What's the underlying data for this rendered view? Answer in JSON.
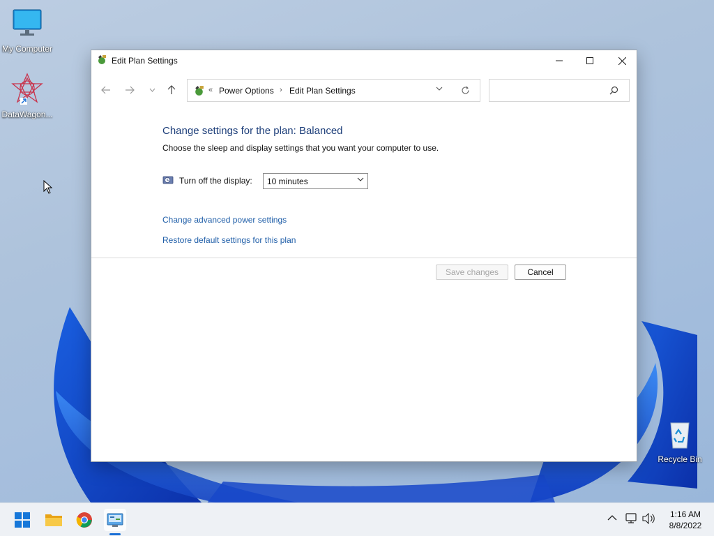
{
  "desktop": {
    "icons": [
      {
        "label": "My Computer",
        "icon": "monitor-icon"
      },
      {
        "label": "DataWagon...",
        "icon": "datawagon-shortcut-icon"
      },
      {
        "label": "Recycle Bin",
        "icon": "recycle-bin-icon"
      }
    ]
  },
  "window": {
    "title": "Edit Plan Settings",
    "controls": {
      "minimize": "minimize-icon",
      "maximize": "maximize-icon",
      "close": "close-icon"
    }
  },
  "navigation": {
    "overflow_chevron": "«",
    "breadcrumbs": [
      "Power Options",
      "Edit Plan Settings"
    ],
    "separator": "›",
    "search_placeholder": ""
  },
  "content": {
    "heading": "Change settings for the plan: Balanced",
    "subtext": "Choose the sleep and display settings that you want your computer to use.",
    "display_setting": {
      "label": "Turn off the display:",
      "value": "10 minutes"
    },
    "links": [
      "Change advanced power settings",
      "Restore default settings for this plan"
    ],
    "buttons": {
      "save": "Save changes",
      "cancel": "Cancel"
    },
    "save_enabled": false
  },
  "taskbar": {
    "items": [
      "start-icon",
      "file-explorer-icon",
      "chrome-icon",
      "control-panel-icon"
    ],
    "active_item": "control-panel-icon",
    "clock": {
      "time": "1:16 AM",
      "date": "8/8/2022"
    }
  },
  "colors": {
    "heading": "#1e3f7a",
    "link": "#1f5ea8",
    "accent": "#1a6fd6"
  }
}
